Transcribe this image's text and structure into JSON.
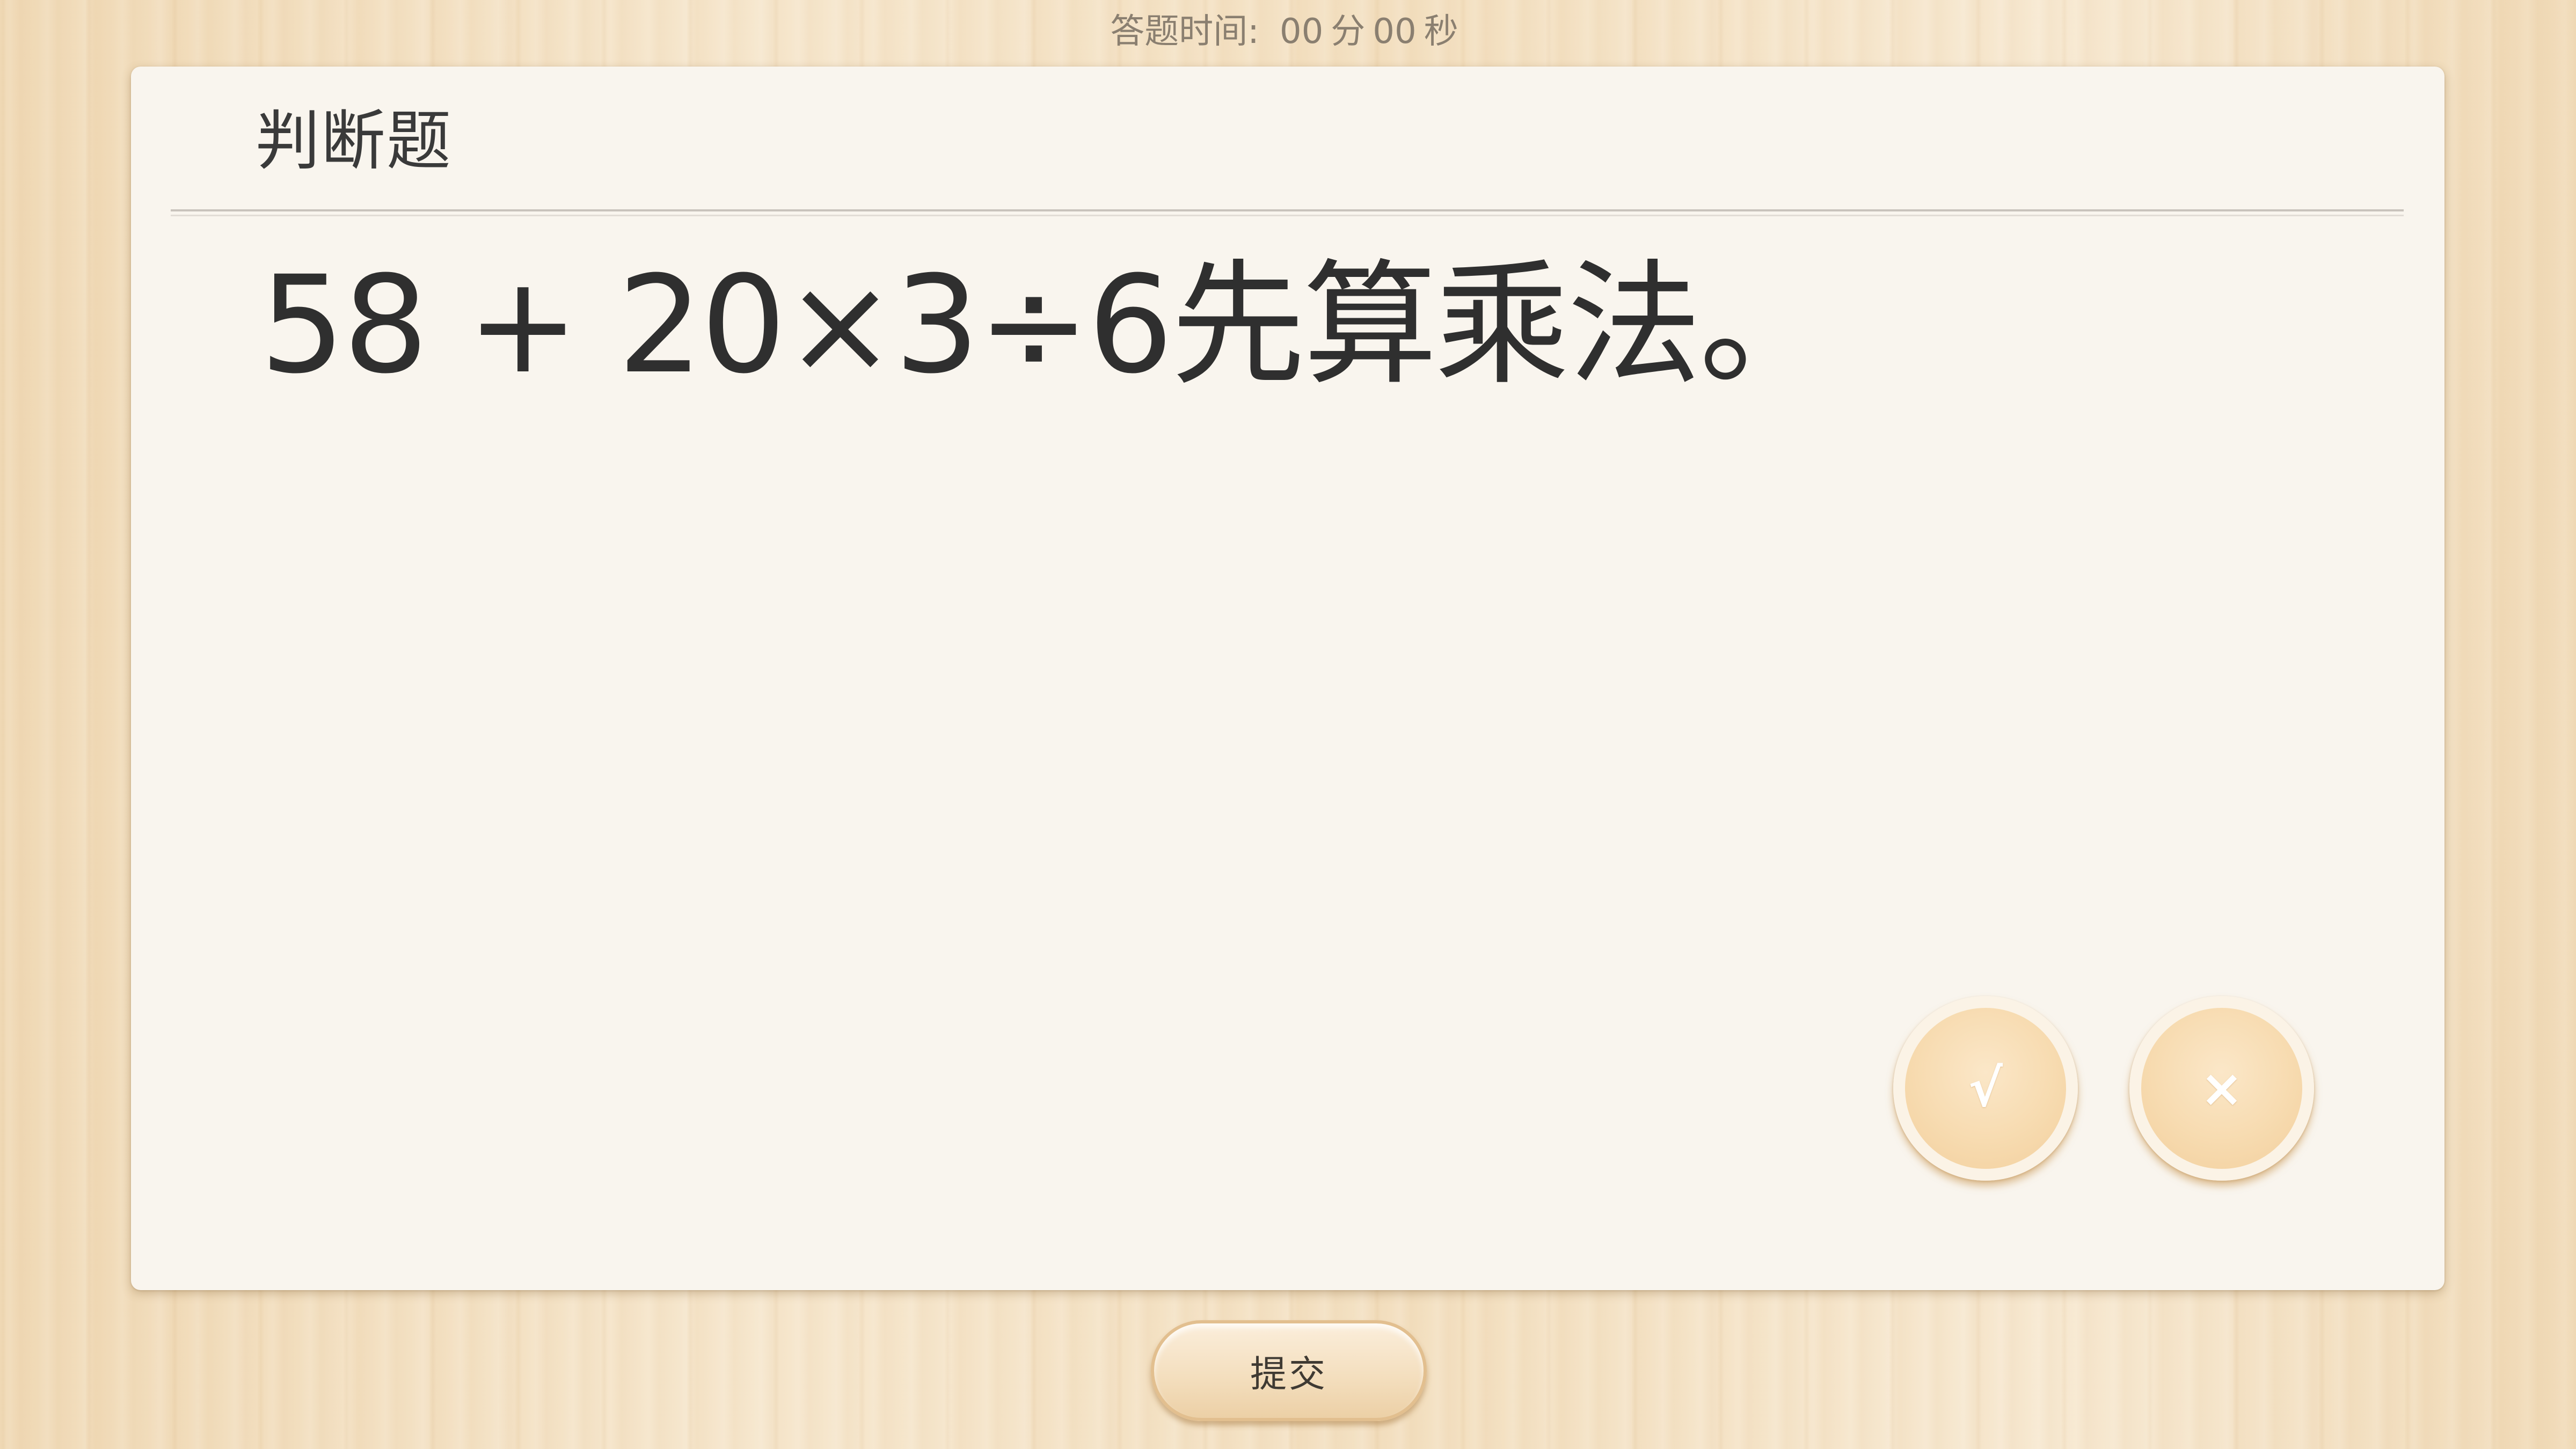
{
  "timer": {
    "label": "答题时间:",
    "minutes": "00",
    "minutes_unit": "分",
    "seconds": "00",
    "seconds_unit": "秒"
  },
  "question": {
    "type": "判断题",
    "text": "58 + 20×3÷6先算乘法。"
  },
  "answers": {
    "true_label": "√",
    "false_label": "×"
  },
  "submit_label": "提交",
  "colors": {
    "background_wood": "#f3dfbf",
    "card": "#f9f5ee",
    "answer_button": "#f7dbb0",
    "text": "#2f2f2f"
  }
}
